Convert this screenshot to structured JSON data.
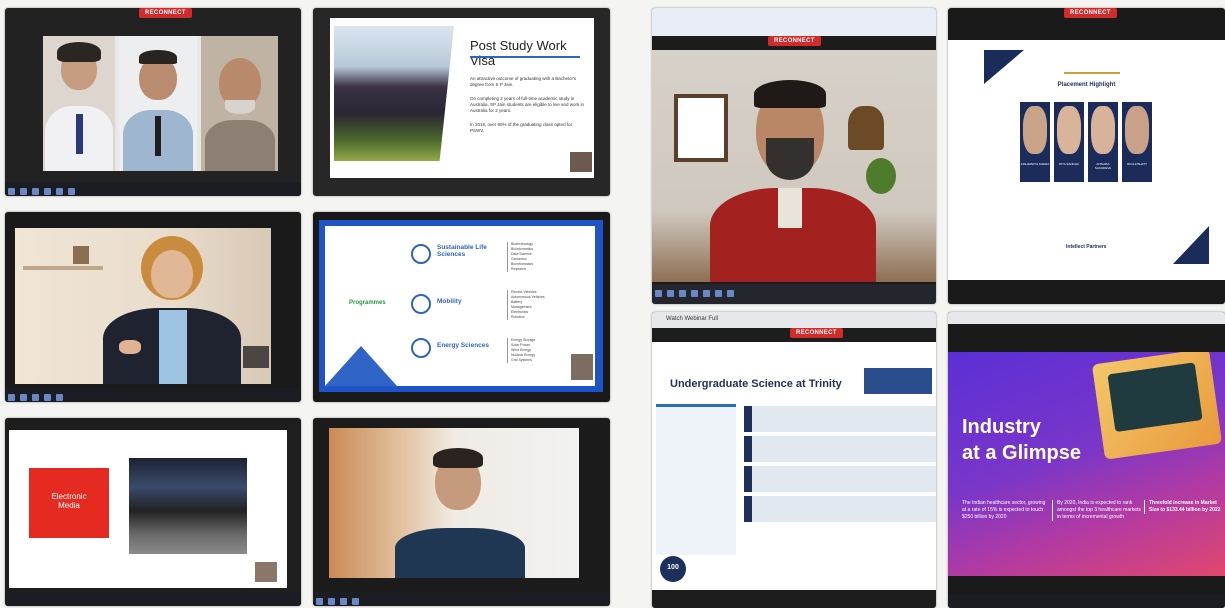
{
  "reconnect_label": "RECONNECT",
  "tiles": {
    "t1": {
      "name": "panel-video-call"
    },
    "t2": {
      "title": "Post Study Work Visa",
      "paragraphs": [
        "An attractive outcome of graduating with a Bachelor's degree from S P Jain.",
        "On completing 2 years of full-time academic study in Australia, SP Jain students are eligible to live and work in Australia for 2 years.",
        "In 2019, over 90% of the graduating class opted for PSWV."
      ]
    },
    "t4": {
      "label": "Programmes",
      "items": [
        {
          "title": "Sustainable Life Sciences",
          "subs": [
            "Biotechnology",
            "Bioinformatics",
            "Data Science",
            "Genomics",
            "Bioinformatics",
            "Research"
          ]
        },
        {
          "title": "Mobility",
          "subs": [
            "Electric Vehicles",
            "Autonomous Vehicles",
            "Battery",
            "Management",
            "Electronics",
            "Robotics"
          ]
        },
        {
          "title": "Energy Sciences",
          "subs": [
            "Energy Storage",
            "Solar Power",
            "Wind Energy",
            "Nuclear Energy",
            "Grid Systems"
          ]
        }
      ]
    },
    "t5": {
      "label": "Electronic\nMedia"
    },
    "t7": {
      "browser_tab": "Watch Webinar Full",
      "title": "Undergraduate Science at Trinity",
      "badge": "100"
    },
    "t8": {
      "title": "Placement Highlight",
      "students": [
        "AISHWARYA KHERA",
        "RIYA SANDHU",
        "ANSHIKA SACHDEVA",
        "RUCHI BHATT"
      ],
      "partner": "Intellect Partners"
    },
    "t9": {
      "title_line1": "Industry",
      "title_line2": "at a Glimpse",
      "facts": [
        "The Indian healthcare sector, growing at a rate of 15% is expected to touch $250 billion by 2020",
        "By 2020, India is expected to rank amongst the top 3 healthcare markets in terms of incremental growth",
        "Threefold increase in Market Size to $133.44 billion by 2022"
      ]
    }
  },
  "colors": {
    "reconnect": "#d32a2a",
    "slide_blue": "#2f63c5",
    "media_red": "#e52b21",
    "industry_purple": "#6c2fd0"
  }
}
